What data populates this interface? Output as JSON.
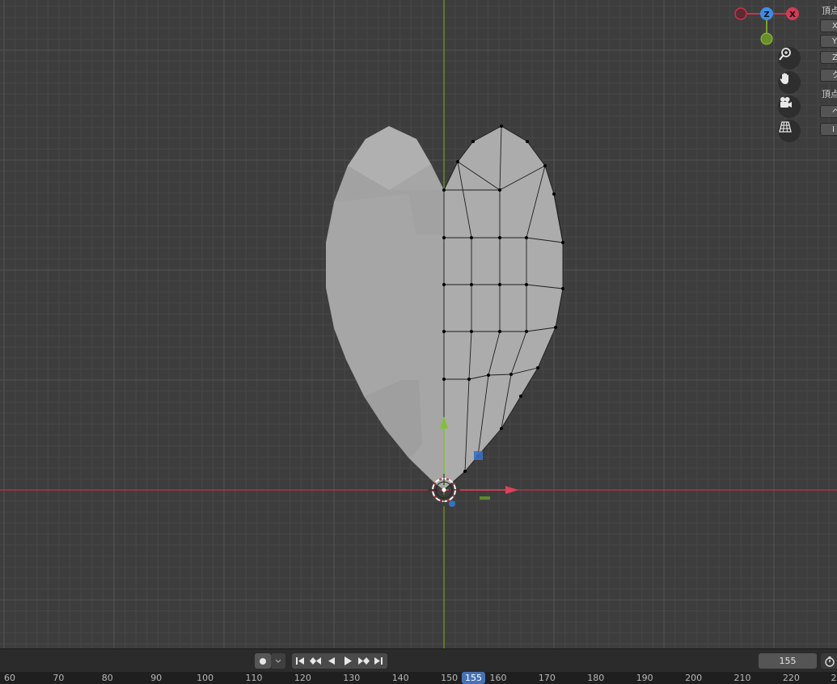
{
  "gizmo": {
    "z_label": "Z",
    "x_label": "X"
  },
  "nav": [
    {
      "name": "zoom-icon"
    },
    {
      "name": "hand-pan-icon"
    },
    {
      "name": "camera-icon"
    },
    {
      "name": "perspective-grid-icon"
    }
  ],
  "right_panel": {
    "vertex_label": "頂点",
    "fields": [
      "X",
      "Y",
      "Z",
      "ク"
    ],
    "vertex_label_2": "頂点",
    "buttons": [
      "ベ",
      "I"
    ]
  },
  "timeline": {
    "current_frame": "155",
    "ruler_current": "155",
    "ticks": [
      "60",
      "70",
      "80",
      "90",
      "100",
      "110",
      "120",
      "130",
      "140",
      "150",
      "160",
      "170",
      "180",
      "190",
      "200",
      "210",
      "220",
      "2"
    ]
  },
  "colors": {
    "x_axis": "#c8324b",
    "y_axis": "#7aa22b",
    "z_axis": "#2e84e6",
    "viewport_bg": "#3d3d3d",
    "mesh": "#a9a9a9"
  }
}
